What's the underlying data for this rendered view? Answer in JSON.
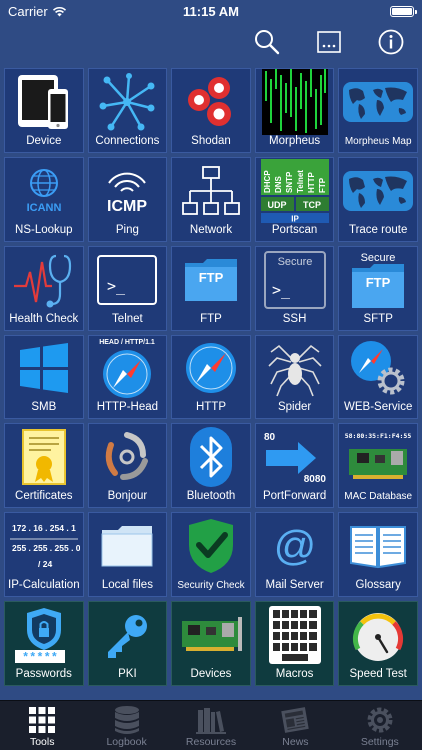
{
  "status": {
    "carrier": "Carrier",
    "time": "11:15 AM"
  },
  "tiles": [
    {
      "label": "Device",
      "icon": "device-icon"
    },
    {
      "label": "Connections",
      "icon": "connections-icon"
    },
    {
      "label": "Shodan",
      "icon": "shodan-icon"
    },
    {
      "label": "Morpheus",
      "icon": "matrix-icon"
    },
    {
      "label": "Morpheus Map",
      "icon": "world-map-icon"
    },
    {
      "label": "NS-Lookup",
      "icon": "icann-icon"
    },
    {
      "label": "Ping",
      "icon": "icmp-icon"
    },
    {
      "label": "Network",
      "icon": "network-icon"
    },
    {
      "label": "Portscan",
      "icon": "portscan-icon"
    },
    {
      "label": "Trace route",
      "icon": "world-map-icon"
    },
    {
      "label": "Health Check",
      "icon": "stethoscope-icon"
    },
    {
      "label": "Telnet",
      "icon": "terminal-icon"
    },
    {
      "label": "FTP",
      "icon": "ftp-folder-icon"
    },
    {
      "label": "SSH",
      "icon": "secure-terminal-icon"
    },
    {
      "label": "SFTP",
      "icon": "secure-ftp-folder-icon"
    },
    {
      "label": "SMB",
      "icon": "windows-icon"
    },
    {
      "label": "HTTP-Head",
      "icon": "compass-icon"
    },
    {
      "label": "HTTP",
      "icon": "compass-icon"
    },
    {
      "label": "Spider",
      "icon": "spider-icon"
    },
    {
      "label": "WEB-Service",
      "icon": "compass-gear-icon"
    },
    {
      "label": "Certificates",
      "icon": "certificate-icon"
    },
    {
      "label": "Bonjour",
      "icon": "bonjour-icon"
    },
    {
      "label": "Bluetooth",
      "icon": "bluetooth-icon"
    },
    {
      "label": "PortForward",
      "icon": "port-forward-icon"
    },
    {
      "label": "MAC Database",
      "icon": "network-card-icon"
    },
    {
      "label": "IP-Calculation",
      "icon": "ip-calc-icon"
    },
    {
      "label": "Local files",
      "icon": "folder-icon"
    },
    {
      "label": "Security Check",
      "icon": "shield-check-icon"
    },
    {
      "label": "Mail Server",
      "icon": "at-sign-icon"
    },
    {
      "label": "Glossary",
      "icon": "book-icon"
    },
    {
      "label": "Passwords",
      "icon": "password-shield-icon"
    },
    {
      "label": "PKI",
      "icon": "key-icon"
    },
    {
      "label": "Devices",
      "icon": "network-card-icon"
    },
    {
      "label": "Macros",
      "icon": "keyboard-icon"
    },
    {
      "label": "Speed Test",
      "icon": "speedometer-icon"
    }
  ],
  "icon_text": {
    "icann": "ICANN",
    "icmp": "ICMP",
    "portscan_protocols": [
      "DHCP",
      "DNS",
      "SNTP",
      "Telnet",
      "HTTP",
      "FTP"
    ],
    "portscan_udp": "UDP",
    "portscan_tcp": "TCP",
    "portscan_ip": "IP",
    "terminal_prompt": ">_",
    "ftp": "FTP",
    "secure": "Secure",
    "http_head": "HEAD / HTTP/1.1",
    "pf_from": "80",
    "pf_to": "8080",
    "mac": "58:80:35:F1:F4:55",
    "ip_addr": "172 . 16 . 254 . 1",
    "ip_mask": "255 . 255 . 255 . 0",
    "ip_cidr": "/ 24",
    "password_mask": "*****"
  },
  "tabs": [
    {
      "label": "Tools",
      "icon": "tools-grid-icon",
      "active": true
    },
    {
      "label": "Logbook",
      "icon": "database-icon",
      "active": false
    },
    {
      "label": "Resources",
      "icon": "books-icon",
      "active": false
    },
    {
      "label": "News",
      "icon": "newspaper-icon",
      "active": false
    },
    {
      "label": "Settings",
      "icon": "gear-icon",
      "active": false
    }
  ],
  "colors": {
    "background": "#2f4b84",
    "tile": "#1f3a78",
    "tile_dark": "#0f3b3f",
    "tabbar": "#1a1f2c",
    "accent_blue": "#2a8ad8"
  }
}
